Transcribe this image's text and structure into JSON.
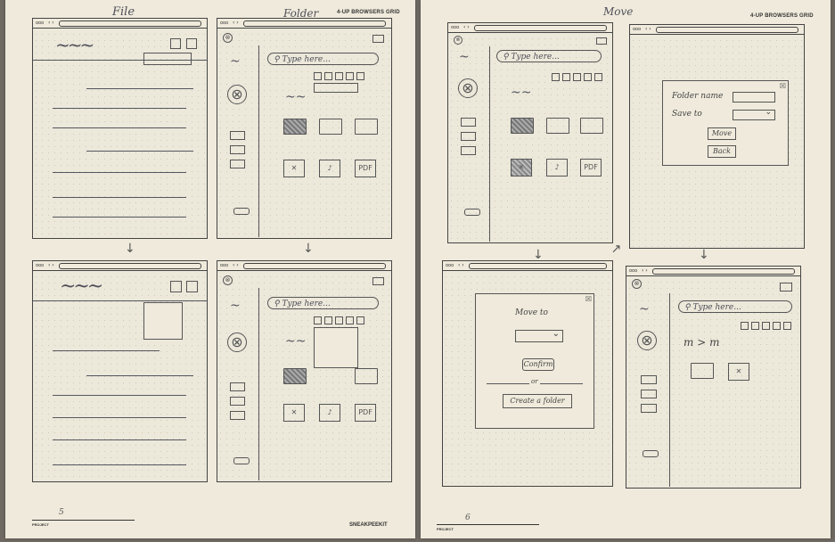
{
  "pages": {
    "left": {
      "grid_title": "4-UP BROWSERS GRID",
      "heading_file": "File",
      "heading_folder": "Folder",
      "page_number": "5",
      "project_label": "PROJECT",
      "brand": "SNEAKPEEKIT"
    },
    "right": {
      "grid_title": "4-UP BROWSERS GRID",
      "heading_move": "Move",
      "page_number": "6",
      "project_label": "PROJECT"
    }
  },
  "browser": {
    "dots": "ooo",
    "nav": "‹ ›"
  },
  "sketch": {
    "squiggle": "~",
    "search_placeholder": "Type here...",
    "pdf_label": "PDF",
    "music_glyph": "♪",
    "folder_name_label": "Folder name",
    "save_to_label": "Save to",
    "move_button": "Move",
    "back_button": "Back",
    "move_to_label": "Move to",
    "confirm_button": "Confirm",
    "or_label": "or",
    "create_folder_button": "Create a folder",
    "breadcrumb": "m > m",
    "close_glyph": "☒",
    "chevron": "⌄",
    "x_glyph": "⊗"
  },
  "icons": [
    "search-icon",
    "close-icon",
    "chevron-down-icon",
    "folder-icon",
    "image-icon",
    "music-icon",
    "pdf-icon",
    "edit-icon",
    "share-icon"
  ]
}
